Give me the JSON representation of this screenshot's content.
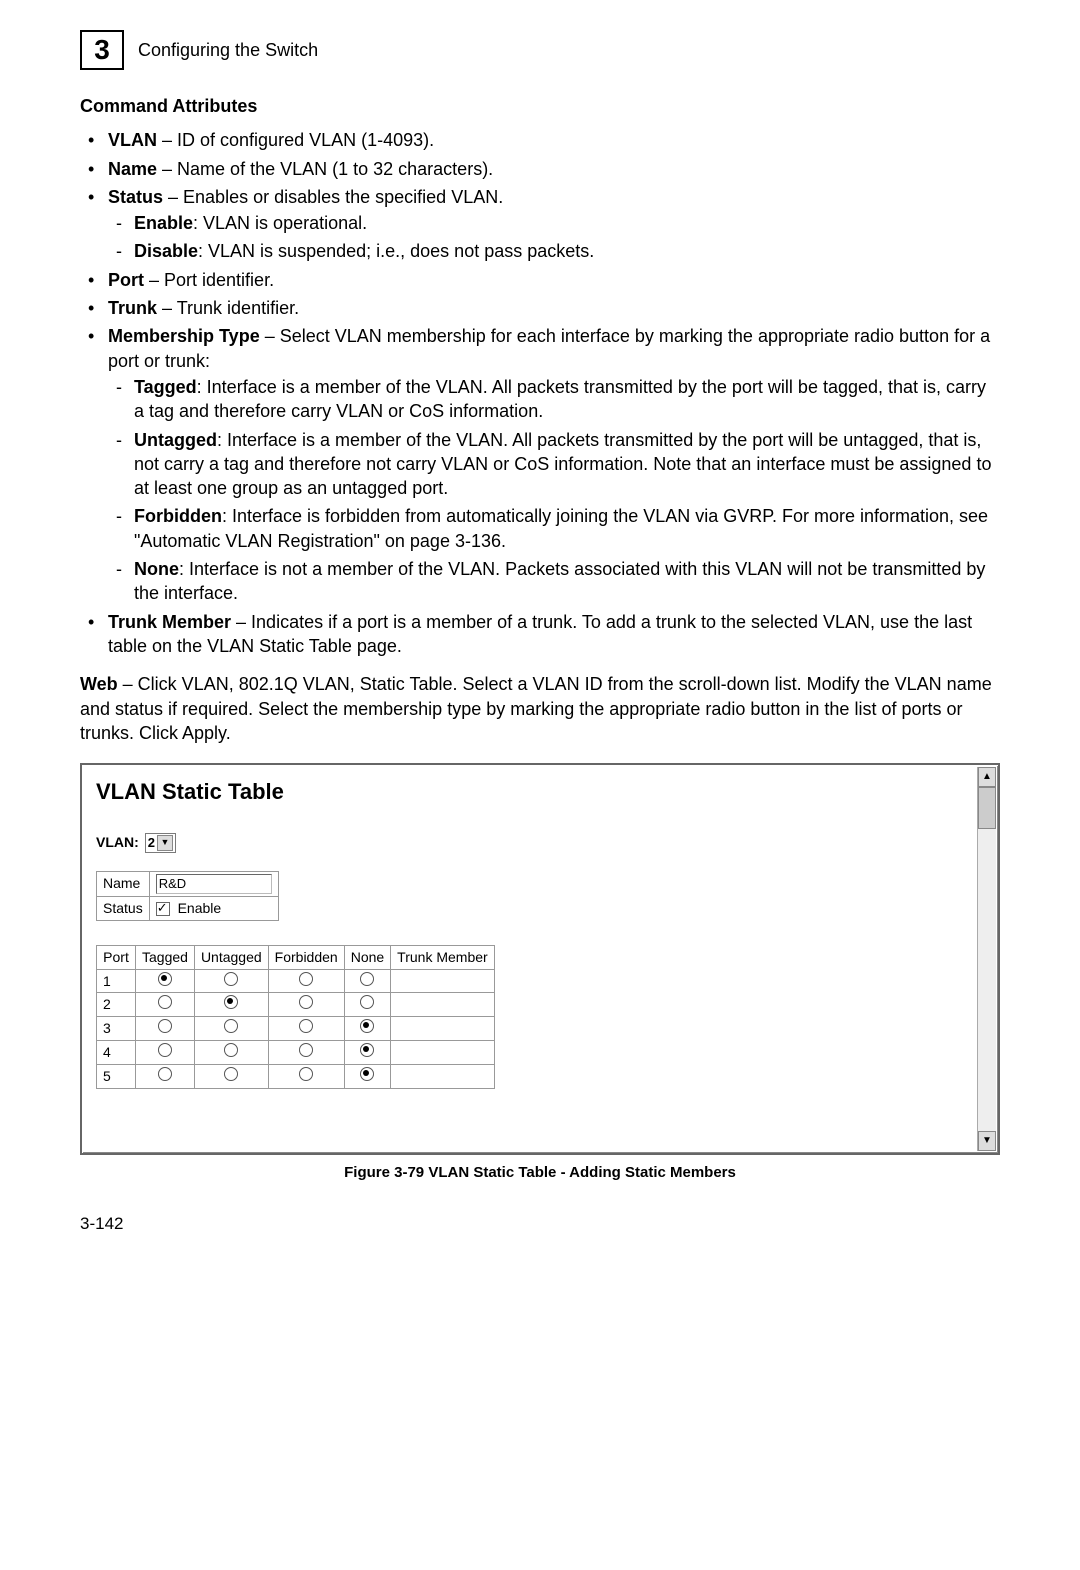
{
  "chapter": {
    "number": "3",
    "title": "Configuring the Switch"
  },
  "section_title": "Command Attributes",
  "attrs": {
    "vlan": {
      "name": "VLAN",
      "desc": " – ID of configured VLAN (1-4093)."
    },
    "name": {
      "name": "Name",
      "desc": " – Name of the VLAN (1 to 32 characters)."
    },
    "status": {
      "name": "Status",
      "desc": " – Enables or disables the specified VLAN.",
      "enable": {
        "name": "Enable",
        "desc": ": VLAN is operational."
      },
      "disable": {
        "name": "Disable",
        "desc": ": VLAN is suspended; i.e., does not pass packets."
      }
    },
    "port": {
      "name": "Port",
      "desc": " – Port identifier."
    },
    "trunk": {
      "name": "Trunk",
      "desc": " – Trunk identifier."
    },
    "membership": {
      "name": "Membership Type",
      "desc": " – Select VLAN membership for each interface by marking the appropriate radio button for a port or trunk:",
      "tagged": {
        "name": "Tagged",
        "desc": ": Interface is a member of the VLAN. All packets transmitted by the port will be tagged, that is, carry a tag and therefore carry VLAN or CoS information."
      },
      "untagged": {
        "name": "Untagged",
        "desc": ": Interface is a member of the VLAN. All packets transmitted by the port will be untagged, that is, not carry a tag and therefore not carry VLAN or CoS information. Note that an interface must be assigned to at least one group as an untagged port."
      },
      "forbidden": {
        "name": "Forbidden",
        "desc": ": Interface is forbidden from automatically joining the VLAN via GVRP. For more information, see \"Automatic VLAN Registration\" on page 3-136."
      },
      "none": {
        "name": "None",
        "desc": ": Interface is not a member of the VLAN. Packets associated with this VLAN will not be transmitted by the interface."
      }
    },
    "trunk_member": {
      "name": "Trunk Member",
      "desc": " – Indicates if a port is a member of a trunk. To add a trunk to the selected VLAN, use the last table on the VLAN Static Table page."
    }
  },
  "web": {
    "label": "Web",
    "text": " – Click VLAN, 802.1Q VLAN, Static Table. Select a VLAN ID from the scroll-down list. Modify the VLAN name and status if required. Select the membership type by marking the appropriate radio button in the list of ports or trunks. Click Apply."
  },
  "panel": {
    "title": "VLAN Static Table",
    "vlan_label": "VLAN:",
    "vlan_value": "2",
    "name_label": "Name",
    "name_value": "R&D",
    "status_label": "Status",
    "status_enable_label": "Enable",
    "columns": [
      "Port",
      "Tagged",
      "Untagged",
      "Forbidden",
      "None",
      "Trunk Member"
    ],
    "rows": [
      {
        "port": "1",
        "sel": "tagged"
      },
      {
        "port": "2",
        "sel": "untagged"
      },
      {
        "port": "3",
        "sel": "none"
      },
      {
        "port": "4",
        "sel": "none"
      },
      {
        "port": "5",
        "sel": "none"
      }
    ]
  },
  "figure_caption": "Figure 3-79   VLAN Static Table - Adding Static Members",
  "page_number": "3-142"
}
